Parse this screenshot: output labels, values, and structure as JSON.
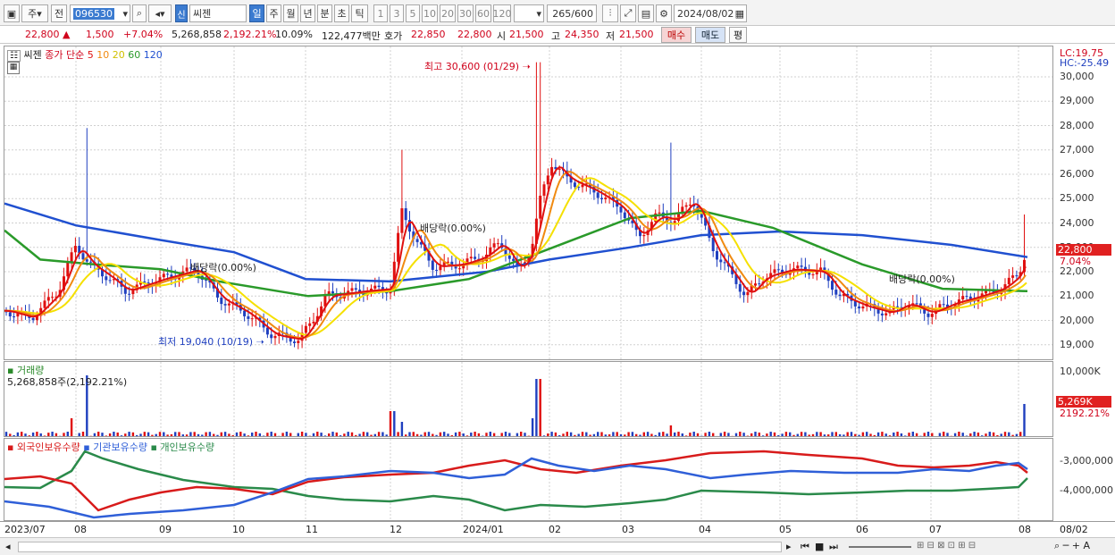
{
  "toolbar": {
    "period_day": "주",
    "prev": "전",
    "code": "096530",
    "stock_name": "씨젠",
    "new_badge": "신",
    "periods": [
      "일",
      "주",
      "월",
      "년",
      "분",
      "초",
      "틱"
    ],
    "minutes": [
      "1",
      "3",
      "5",
      "10",
      "20",
      "30",
      "60",
      "120"
    ],
    "count": "265",
    "count_total": "/600",
    "date": "2024/08/02"
  },
  "quote": {
    "price": "22,800 ▲",
    "change": "1,500",
    "change_pct": "+7.04%",
    "volume": "5,268,858",
    "volume_ratio": "2,192.21%",
    "turnover": "10.09%",
    "amount": "122,477백만",
    "bid_label": "호가",
    "bid": "22,850",
    "ask": "22,800",
    "open_label": "시",
    "open": "21,500",
    "high_label": "고",
    "high": "24,350",
    "low_label": "저",
    "low": "21,500",
    "buy": "매수",
    "sell": "매도",
    "eval": "평"
  },
  "price_panel": {
    "stock": "씨젠",
    "legend_prefix": "종가 단순",
    "ma": [
      "5",
      "10",
      "20",
      "60",
      "120"
    ],
    "ma_colors": [
      "#e01010",
      "#f08a10",
      "#f5e000",
      "#2a9a2a",
      "#2050d0"
    ],
    "lc": "LC:19.75",
    "hc": "HC:-25.49",
    "y_ticks": [
      "30,000",
      "29,000",
      "28,000",
      "27,000",
      "26,000",
      "25,000",
      "24,000",
      "23,000",
      "22,000",
      "21,000",
      "20,000",
      "19,000"
    ],
    "last_price": "22,800",
    "last_pct": "7.04%",
    "high_note": "최고 30,600 (01/29)",
    "low_note": "최저 19,040 (10/19)",
    "dividend_notes": [
      "배당락(0.00%)",
      "배당락(0.00%)",
      "배당락(0.00%)"
    ]
  },
  "volume_panel": {
    "title": "거래량",
    "value": "5,268,858주(2,192.21%)",
    "y_tick": "10,000K",
    "last": "5,269K",
    "last_pct": "2192.21%"
  },
  "holdings_panel": {
    "foreign": "외국인보유수량",
    "institution": "기관보유수량",
    "individual": "개인보유수량",
    "y_ticks": [
      "-3,000,000",
      "-4,000,000"
    ]
  },
  "x_axis": {
    "labels": [
      "2023/07",
      "08",
      "09",
      "10",
      "11",
      "12",
      "2024/01",
      "02",
      "03",
      "04",
      "05",
      "06",
      "07",
      "08"
    ],
    "right": "08/02"
  },
  "chart_data": [
    {
      "type": "candlestick",
      "title": "씨젠",
      "ylim": [
        18600,
        30700
      ],
      "ma_periods": [
        5,
        10,
        20,
        60,
        120
      ],
      "x": [
        "2023/07",
        "08",
        "09",
        "10",
        "11",
        "12",
        "2024/01",
        "02",
        "03",
        "04",
        "05",
        "06",
        "07",
        "08"
      ],
      "close_approx": [
        20500,
        22500,
        21800,
        19800,
        21200,
        22500,
        24000,
        26000,
        24000,
        22000,
        22500,
        20500,
        20800,
        22800
      ],
      "annotations": {
        "high": {
          "value": 30600,
          "date": "01/29"
        },
        "low": {
          "value": 19040,
          "date": "10/19"
        }
      }
    },
    {
      "type": "bar",
      "title": "거래량",
      "last": 5268858,
      "ylim": [
        0,
        10000000
      ]
    },
    {
      "type": "line",
      "series": [
        {
          "name": "외국인보유수량"
        },
        {
          "name": "기관보유수량"
        },
        {
          "name": "개인보유수량"
        }
      ]
    }
  ]
}
